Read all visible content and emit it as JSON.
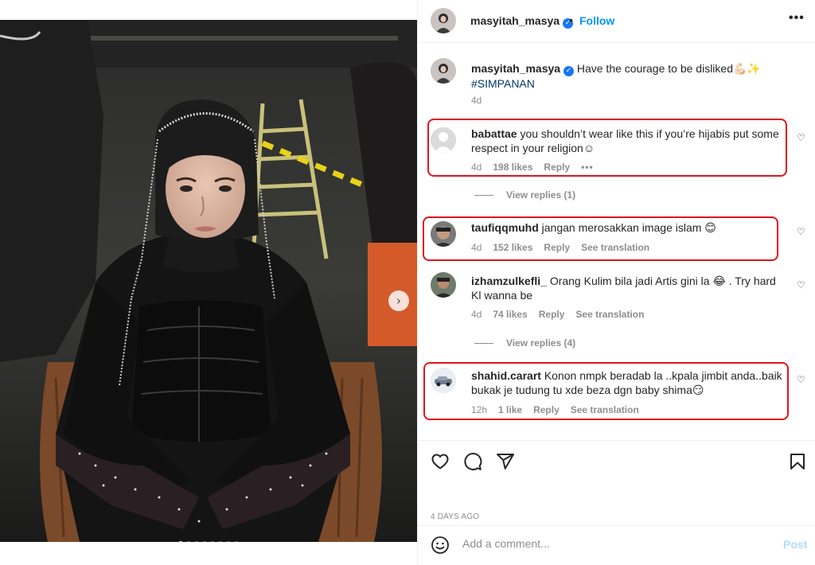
{
  "header": {
    "username": "masyitah_masya",
    "separator": "•",
    "follow_label": "Follow",
    "more_icon": "more-horizontal-icon"
  },
  "caption": {
    "username": "masyitah_masya",
    "text": "Have the courage to be disliked💪🏻✨",
    "hashtag": "#SIMPANAN",
    "time": "4d"
  },
  "comments": [
    {
      "username": "babattae",
      "text": "you shouldn’t wear like this if you’re hijabis put some respect in your religion☺︎",
      "time": "4d",
      "likes": "198 likes",
      "reply": "Reply",
      "extra": "•••",
      "view_replies": "View replies (1)"
    },
    {
      "username": "taufiqqmuhd",
      "text": "jangan merosakkan image islam 😊",
      "time": "4d",
      "likes": "152 likes",
      "reply": "Reply",
      "translation": "See translation"
    },
    {
      "username": "izhamzulkefli_",
      "text": "Orang Kulim bila jadi Artis gini la 😂 . Try hard Kl wanna be",
      "time": "4d",
      "likes": "74 likes",
      "reply": "Reply",
      "translation": "See translation",
      "view_replies": "View replies (4)"
    },
    {
      "username": "shahid.carart",
      "text": "Konon nmpk beradab la ..kpala jimbit anda..baik bukak je tudung tu xde beza dgn baby shima😏",
      "time": "12h",
      "likes": "1 like",
      "reply": "Reply",
      "translation": "See translation"
    }
  ],
  "actions": {
    "like_icon": "heart-icon",
    "comment_icon": "comment-icon",
    "share_icon": "share-icon",
    "save_icon": "bookmark-icon",
    "date": "4 DAYS AGO"
  },
  "add_comment": {
    "placeholder": "Add a comment...",
    "post_label": "Post",
    "emoji_icon": "emoji-icon"
  },
  "carousel": {
    "slide_count": 8,
    "active_index": 0,
    "next_icon": "chevron-right-icon"
  },
  "colors": {
    "accent": "#0095f6",
    "highlight": "#e0141e",
    "muted": "#8e8e8e"
  }
}
